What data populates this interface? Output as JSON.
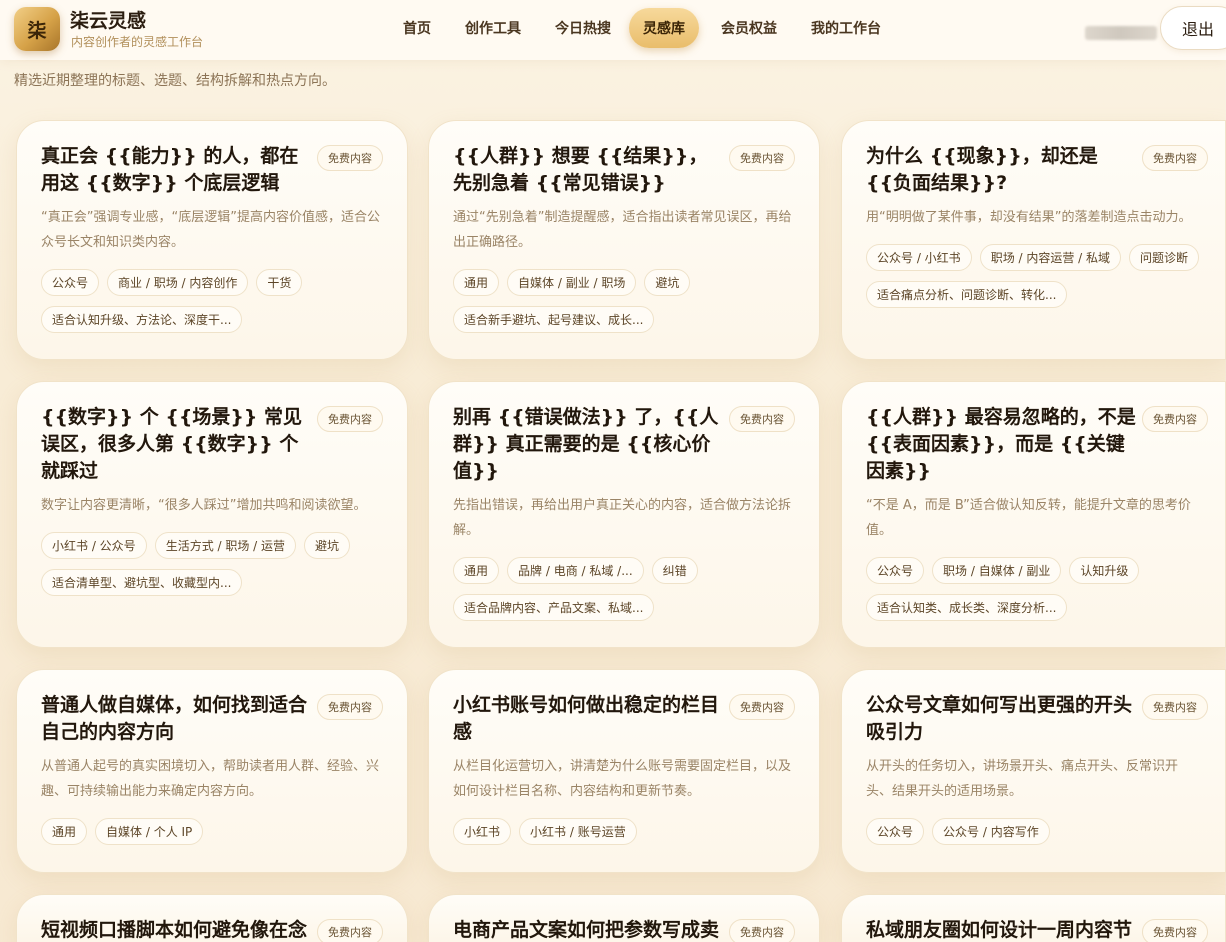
{
  "brand": {
    "logo_char": "柒",
    "name": "柒云灵感",
    "subtitle": "内容创作者的灵感工作台"
  },
  "nav": {
    "items": [
      {
        "label": "首页"
      },
      {
        "label": "创作工具"
      },
      {
        "label": "今日热搜"
      },
      {
        "label": "灵感库",
        "active": true
      },
      {
        "label": "会员权益"
      },
      {
        "label": "我的工作台"
      }
    ]
  },
  "account": {
    "logout_label": "退出"
  },
  "intro": "精选近期整理的标题、选题、结构拆解和热点方向。",
  "cards": [
    {
      "title": "真正会 {{能力}} 的人，都在用这 {{数字}} 个底层逻辑",
      "badge": "免费内容",
      "desc": "“真正会”强调专业感，“底层逻辑”提高内容价值感，适合公众号长文和知识类内容。",
      "tags": [
        "公众号",
        "商业 / 职场 / 内容创作",
        "干货",
        "适合认知升级、方法论、深度干..."
      ]
    },
    {
      "title": "{{人群}} 想要 {{结果}}，先别急着 {{常见错误}}",
      "badge": "免费内容",
      "desc": "通过“先别急着”制造提醒感，适合指出读者常见误区，再给出正确路径。",
      "tags": [
        "通用",
        "自媒体 / 副业 / 职场",
        "避坑",
        "适合新手避坑、起号建议、成长..."
      ]
    },
    {
      "title": "为什么 {{现象}}，却还是 {{负面结果}}?",
      "badge": "免费内容",
      "desc": "用“明明做了某件事，却没有结果”的落差制造点击动力。",
      "tags": [
        "公众号 / 小红书",
        "职场 / 内容运营 / 私域",
        "问题诊断",
        "适合痛点分析、问题诊断、转化..."
      ]
    },
    {
      "title": "{{数字}} 个 {{场景}} 常见误区，很多人第 {{数字}} 个就踩过",
      "badge": "免费内容",
      "desc": "数字让内容更清晰，“很多人踩过”增加共鸣和阅读欲望。",
      "tags": [
        "小红书 / 公众号",
        "生活方式 / 职场 / 运营",
        "避坑",
        "适合清单型、避坑型、收藏型内..."
      ]
    },
    {
      "title": "别再 {{错误做法}} 了，{{人群}} 真正需要的是 {{核心价值}}",
      "badge": "免费内容",
      "desc": "先指出错误，再给出用户真正关心的内容，适合做方法论拆解。",
      "tags": [
        "通用",
        "品牌 / 电商 / 私域 /...",
        "纠错",
        "适合品牌内容、产品文案、私域..."
      ]
    },
    {
      "title": "{{人群}} 最容易忽略的，不是 {{表面因素}}，而是 {{关键因素}}",
      "badge": "免费内容",
      "desc": "“不是 A，而是 B”适合做认知反转，能提升文章的思考价值。",
      "tags": [
        "公众号",
        "职场 / 自媒体 / 副业",
        "认知升级",
        "适合认知类、成长类、深度分析..."
      ]
    },
    {
      "title": "普通人做自媒体，如何找到适合自己的内容方向",
      "badge": "免费内容",
      "desc": "从普通人起号的真实困境切入，帮助读者用人群、经验、兴趣、可持续输出能力来确定内容方向。",
      "tags": [
        "通用",
        "自媒体 / 个人 IP"
      ]
    },
    {
      "title": "小红书账号如何做出稳定的栏目感",
      "badge": "免费内容",
      "desc": "从栏目化运营切入，讲清楚为什么账号需要固定栏目，以及如何设计栏目名称、内容结构和更新节奏。",
      "tags": [
        "小红书",
        "小红书 / 账号运营"
      ]
    },
    {
      "title": "公众号文章如何写出更强的开头吸引力",
      "badge": "免费内容",
      "desc": "从开头的任务切入，讲场景开头、痛点开头、反常识开头、结果开头的适用场景。",
      "tags": [
        "公众号",
        "公众号 / 内容写作"
      ]
    },
    {
      "title": "短视频口播脚本如何避免像在念稿",
      "badge": "免费内容",
      "desc": "",
      "tags": []
    },
    {
      "title": "电商产品文案如何把参数写成卖点",
      "badge": "免费内容",
      "desc": "",
      "tags": []
    },
    {
      "title": "私域朋友圈如何设计一周内容节奏",
      "badge": "免费内容",
      "desc": "",
      "tags": []
    }
  ]
}
